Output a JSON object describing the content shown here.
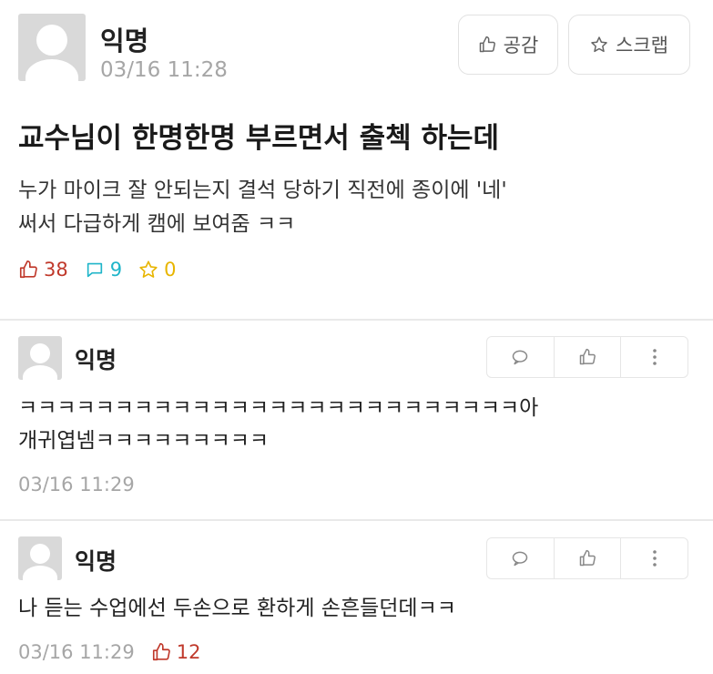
{
  "post": {
    "author": "익명",
    "time": "03/16 11:28",
    "like_button": "공감",
    "scrap_button": "스크랩",
    "title": "교수님이 한명한명 부르면서 출첵 하는데",
    "body_line1": "누가 마이크 잘 안되는지 결석 당하기 직전에 종이에 '네'",
    "body_line2": "써서 다급하게 캠에 보여줌 ㅋㅋ",
    "likes": "38",
    "comments": "9",
    "scraps": "0",
    "colors": {
      "likes": "#c0392b",
      "comments": "#1fb5c9",
      "scraps": "#e8b500"
    }
  },
  "comments": [
    {
      "author": "익명",
      "text_line1": "ㅋㅋㅋㅋㅋㅋㅋㅋㅋㅋㅋㅋㅋㅋㅋㅋㅋㅋㅋㅋㅋㅋㅋㅋㅋㅋ아",
      "text_line2": "개귀엽넴ㅋㅋㅋㅋㅋㅋㅋㅋㅋ",
      "time": "03/16 11:29"
    },
    {
      "author": "익명",
      "text_line1": "나 듣는 수업에선 두손으로 환하게 손흔들던데ㅋㅋ",
      "time": "03/16 11:29",
      "likes": "12"
    }
  ],
  "icons": {
    "like": "thumbs-up-icon",
    "comment": "speech-bubble-icon",
    "scrap": "star-icon",
    "more": "vertical-dots-icon"
  }
}
